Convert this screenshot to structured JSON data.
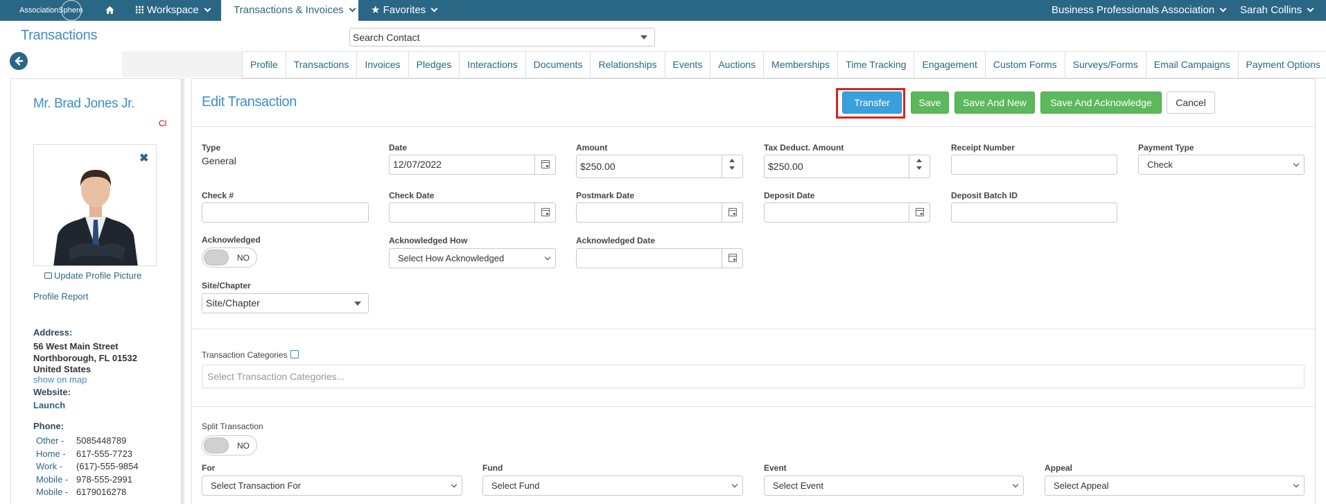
{
  "brand": {
    "logo_text": "AssociationSphere"
  },
  "topnav": {
    "workspace": "Workspace",
    "transactions": "Transactions & Invoices",
    "favorites": "Favorites",
    "org": "Business Professionals Association",
    "user": "Sarah Collins"
  },
  "header": {
    "title": "Transactions",
    "search_value": "Search Contact"
  },
  "tabs": [
    "Profile",
    "Transactions",
    "Invoices",
    "Pledges",
    "Interactions",
    "Documents",
    "Relationships",
    "Events",
    "Auctions",
    "Memberships",
    "Time Tracking",
    "Engagement",
    "Custom Forms",
    "Surveys/Forms",
    "Email Campaigns",
    "Payment Options"
  ],
  "contact": {
    "name": "Mr. Brad Jones Jr.",
    "code": "Cl",
    "update_picture": "Update Profile Picture",
    "profile_report": "Profile Report",
    "address_label": "Address:",
    "address_lines": [
      "56 West Main Street",
      "Northborough, FL 01532",
      "United States"
    ],
    "show_on_map": "show on map",
    "website_label": "Website:",
    "website_link": "Launch",
    "phone_label": "Phone:",
    "phones": [
      {
        "type": "Other -",
        "number": "5085448789"
      },
      {
        "type": "Home -",
        "number": "617-555-7723"
      },
      {
        "type": "Work -",
        "number": "(617)-555-9854"
      },
      {
        "type": "Mobile -",
        "number": "978-555-2991"
      },
      {
        "type": "Mobile -",
        "number": "6179016278"
      }
    ]
  },
  "form": {
    "title": "Edit Transaction",
    "buttons": {
      "transfer": "Transfer",
      "save": "Save",
      "save_new": "Save And New",
      "save_ack": "Save And Acknowledge",
      "cancel": "Cancel"
    },
    "type_label": "Type",
    "type_value": "General",
    "date_label": "Date",
    "date_value": "12/07/2022",
    "amount_label": "Amount",
    "amount_value": "$250.00",
    "tax_label": "Tax Deduct. Amount",
    "tax_value": "$250.00",
    "receipt_label": "Receipt Number",
    "receipt_value": "",
    "payment_type_label": "Payment Type",
    "payment_type_value": "Check",
    "check_no_label": "Check #",
    "check_date_label": "Check Date",
    "postmark_label": "Postmark Date",
    "deposit_date_label": "Deposit Date",
    "deposit_batch_label": "Deposit Batch ID",
    "ack_label": "Acknowledged",
    "ack_toggle": "NO",
    "ack_how_label": "Acknowledged How",
    "ack_how_value": "Select How Acknowledged",
    "ack_date_label": "Acknowledged Date",
    "site_label": "Site/Chapter",
    "site_value": "Site/Chapter",
    "categories_label": "Transaction Categories",
    "categories_placeholder": "Select Transaction Categories...",
    "split_label": "Split Transaction",
    "split_toggle": "NO",
    "for_label": "For",
    "for_value": "Select Transaction For",
    "fund_label": "Fund",
    "fund_value": "Select Fund",
    "event_label": "Event",
    "event_value": "Select Event",
    "appeal_label": "Appeal",
    "appeal_value": "Select Appeal"
  }
}
